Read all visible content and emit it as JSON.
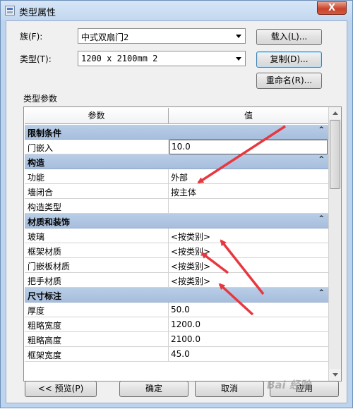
{
  "window": {
    "title": "类型属性",
    "close_label": "X"
  },
  "family": {
    "label": "族(F):",
    "value": "中式双扇门2"
  },
  "type": {
    "label": "类型(T):",
    "value": "1200 x 2100mm 2"
  },
  "buttons": {
    "load": "载入(L)...",
    "duplicate": "复制(D)...",
    "rename": "重命名(R)...",
    "preview": "<< 预览(P)",
    "ok": "确定",
    "cancel": "取消",
    "apply": "应用"
  },
  "params_title": "类型参数",
  "grid": {
    "col_param": "参数",
    "col_value": "值",
    "groups": [
      {
        "name": "限制条件",
        "rows": [
          {
            "name": "门嵌入",
            "value": "10.0"
          }
        ]
      },
      {
        "name": "构造",
        "rows": [
          {
            "name": "功能",
            "value": "外部"
          },
          {
            "name": "墙闭合",
            "value": "按主体"
          },
          {
            "name": "构造类型",
            "value": ""
          }
        ]
      },
      {
        "name": "材质和装饰",
        "rows": [
          {
            "name": "玻璃",
            "value": "<按类别>"
          },
          {
            "name": "框架材质",
            "value": "<按类别>"
          },
          {
            "name": "门嵌板材质",
            "value": "<按类别>"
          },
          {
            "name": "把手材质",
            "value": "<按类别>"
          }
        ]
      },
      {
        "name": "尺寸标注",
        "rows": [
          {
            "name": "厚度",
            "value": "50.0"
          },
          {
            "name": "粗略宽度",
            "value": "1200.0"
          },
          {
            "name": "粗略高度",
            "value": "2100.0"
          },
          {
            "name": "框架宽度",
            "value": "45.0"
          }
        ]
      }
    ]
  },
  "icons": {
    "collapse": "^",
    "scroll_up": "up-arrow",
    "scroll_down": "down-arrow"
  },
  "colors": {
    "group_header": "#a7bedd",
    "annotation_arrow": "#e8373e"
  },
  "watermark": "Bai 经验"
}
